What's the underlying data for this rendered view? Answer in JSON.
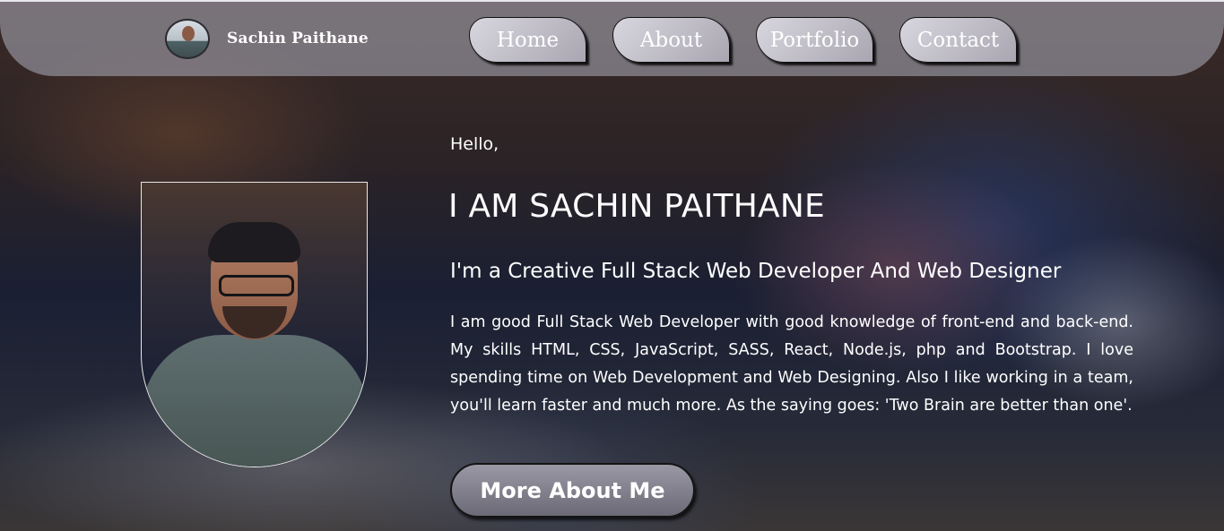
{
  "header": {
    "brand_name": "Sachin Paithane",
    "nav": {
      "home": "Home",
      "about": "About",
      "portfolio": "Portfolio",
      "contact": "Contact"
    }
  },
  "hero": {
    "greeting": "Hello,",
    "title": "I AM SACHIN PAITHANE",
    "subtitle": "I'm a Creative Full Stack Web Developer And Web Designer",
    "bio": "I am good Full Stack Web Developer with good knowledge of front-end and back-end. My skills HTML, CSS, JavaScript, SASS, React, Node.js, php and Bootstrap. I love spending time on Web Development and Web Designing. Also I like working in a team, you'll learn faster and much more. As the saying goes: 'Two Brain are better than one'.",
    "cta_label": "More About Me"
  },
  "colors": {
    "nav_bar": "#a0a0ac",
    "button_fill": "#9a98a4",
    "text": "#ffffff"
  }
}
